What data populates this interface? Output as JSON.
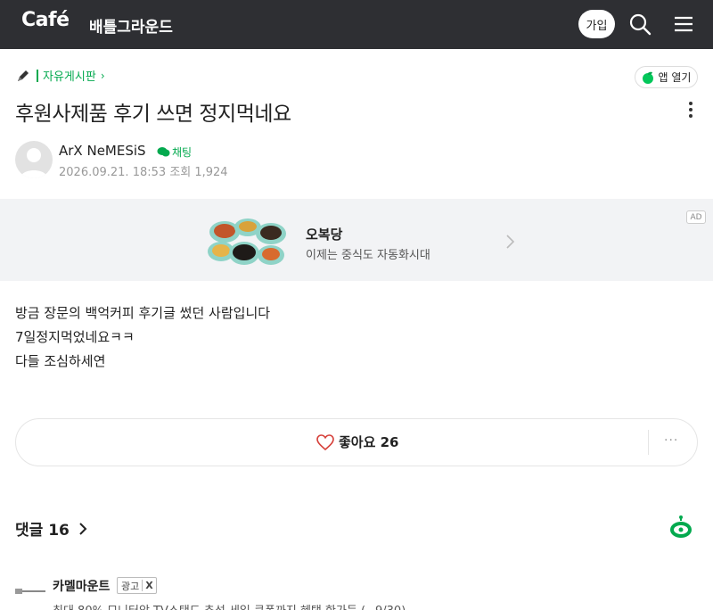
{
  "header": {
    "logo": "Café",
    "cafe_name": "배틀그라운드",
    "join_label": "가입",
    "search_icon": "search-icon",
    "menu_icon": "hamburger-menu-icon"
  },
  "post": {
    "board_name": "자유게시판",
    "open_app_label": "앱 열기",
    "title": "후원사제품 후기 쓰면 정지먹네요",
    "author": "ArX NeMESiS",
    "chat_label": "채팅",
    "date": "2026.09.21. 18:53",
    "views_label": "조회 1,924",
    "body": [
      "방금 장문의 백억커피 후기글 썼던 사람입니다",
      "7일정지먹었네요ㅋㅋ",
      "다들 조심하세연"
    ],
    "like_label": "좋아요 26",
    "more_label": "···"
  },
  "ad": {
    "label": "AD",
    "name": "오복당",
    "desc": "이제는 중식도 자동화시대"
  },
  "comments": {
    "heading": "댓글 16"
  },
  "ad2": {
    "name": "카멜마운트",
    "badge": "광고",
    "badge_close": "X",
    "text": "최대 80% 모니터암 TV스탠드 추석 세일 쿠폰까지 혜택 한가득 (~9/30)"
  },
  "colors": {
    "header_bg": "#2e2f33",
    "accent_green": "#03a94e"
  }
}
